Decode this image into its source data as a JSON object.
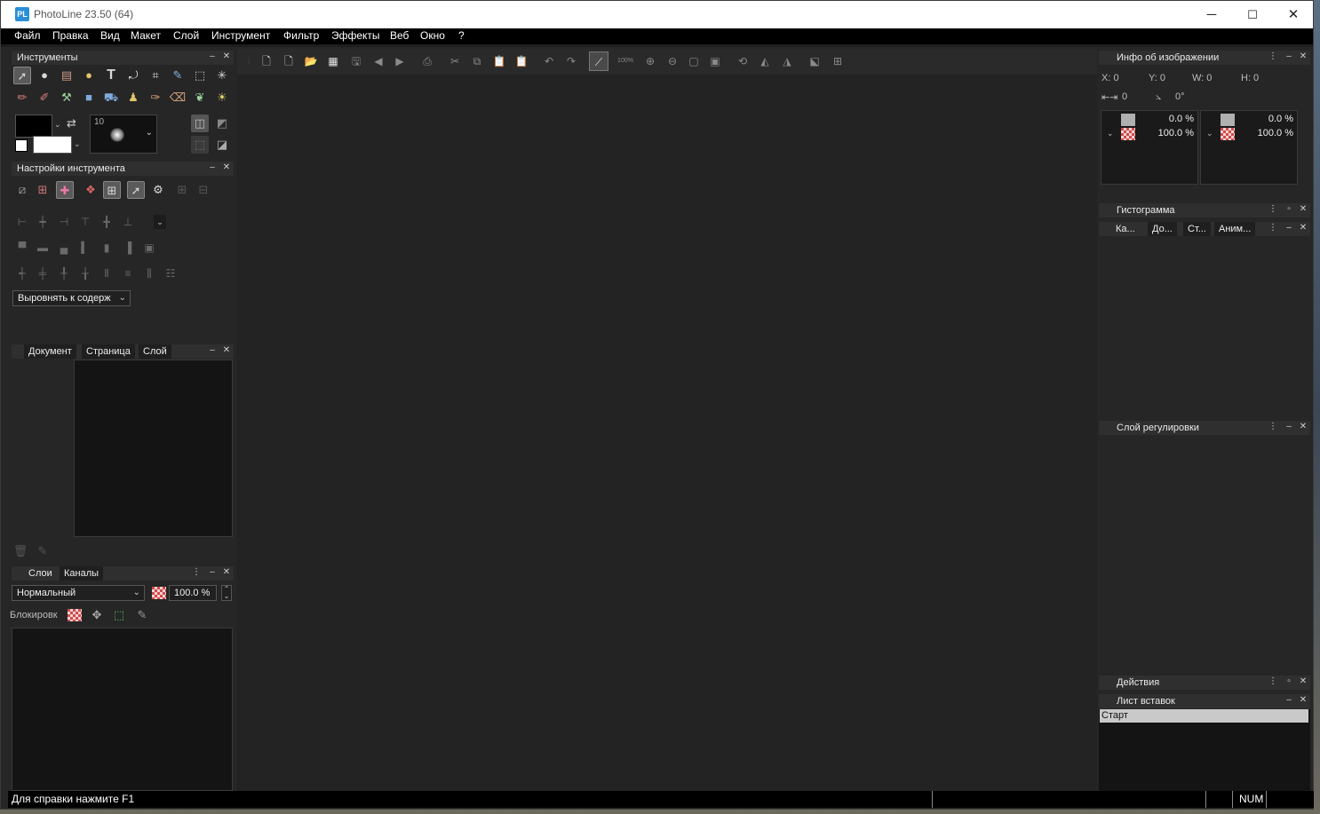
{
  "window": {
    "title": "PhotoLine 23.50 (64)",
    "logo_text": "PL",
    "minimize_label": "─",
    "maximize_label": "☐",
    "close_label": "✕"
  },
  "menu": [
    "Файл",
    "Правка",
    "Вид",
    "Макет",
    "Слой",
    "Инструмент",
    "Фильтр",
    "Эффекты",
    "Веб",
    "Окно",
    "?"
  ],
  "tools_panel": {
    "title": "Инструменты",
    "brush_size": "10"
  },
  "tool_settings": {
    "title": "Настройки инструмента",
    "align_select": "Выровнять к содерж"
  },
  "doc_panel": {
    "tabs": [
      "Документ",
      "Страница",
      "Слой"
    ]
  },
  "layers_panel": {
    "tabs": [
      "Слои",
      "Каналы"
    ],
    "blend_mode": "Нормальный",
    "opacity": "100.0 %",
    "lock_label": "Блокировк"
  },
  "image_info": {
    "title": "Инфо об изображении",
    "x": "X: 0",
    "y": "Y: 0",
    "w": "W: 0",
    "h": "H: 0",
    "dist": "0",
    "angle": "0°",
    "left_box": {
      "top_pct": "0.0 %",
      "bottom_pct": "100.0 %"
    },
    "right_box": {
      "top_pct": "0.0 %",
      "bottom_pct": "100.0 %"
    }
  },
  "histogram": {
    "title": "Гистограмма",
    "tabs": [
      "Ка...",
      "До...",
      "Ст...",
      "Аним..."
    ]
  },
  "adjust_layer": {
    "title": "Слой регулировки"
  },
  "actions": {
    "title": "Действия"
  },
  "insert_list": {
    "title": "Лист вставок",
    "items": [
      "Старт"
    ]
  },
  "status": {
    "help": "Для справки нажмите F1",
    "num": "NUM"
  },
  "toolbar": {
    "zoom_label": "100%"
  }
}
